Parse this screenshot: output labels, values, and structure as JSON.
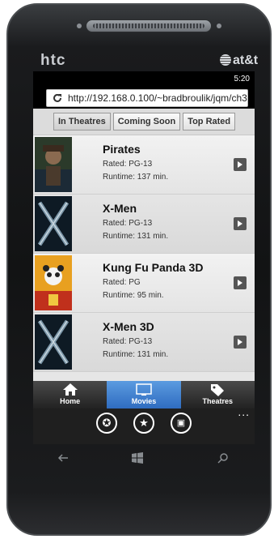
{
  "device": {
    "brand": "htc",
    "carrier": "at&t",
    "status_time": "5:20"
  },
  "browser": {
    "url": "http://192.168.0.100/~bradbroulik/jqm/ch3"
  },
  "tabs": [
    {
      "label": "In Theatres",
      "active": true
    },
    {
      "label": "Coming Soon",
      "active": false
    },
    {
      "label": "Top Rated",
      "active": false
    }
  ],
  "movies": [
    {
      "title": "Pirates",
      "rating": "Rated: PG-13",
      "runtime": "Runtime: 137 min."
    },
    {
      "title": "X-Men",
      "rating": "Rated: PG-13",
      "runtime": "Runtime: 131 min."
    },
    {
      "title": "Kung Fu Panda 3D",
      "rating": "Rated: PG",
      "runtime": "Runtime: 95 min."
    },
    {
      "title": "X-Men 3D",
      "rating": "Rated: PG-13",
      "runtime": "Runtime: 131 min."
    }
  ],
  "navbar": [
    {
      "label": "Home",
      "icon": "home-icon",
      "active": false
    },
    {
      "label": "Movies",
      "icon": "movies-icon",
      "active": true
    },
    {
      "label": "Theatres",
      "icon": "tag-icon",
      "active": false
    }
  ],
  "appbar": {
    "buttons": [
      "star-circle-icon",
      "star-filled-circle-icon",
      "tabs-icon"
    ],
    "more": "..."
  },
  "colors": {
    "nav_active": "#3d7fd0",
    "screen_bg": "#000000",
    "list_bg": "#e6e6e6"
  }
}
